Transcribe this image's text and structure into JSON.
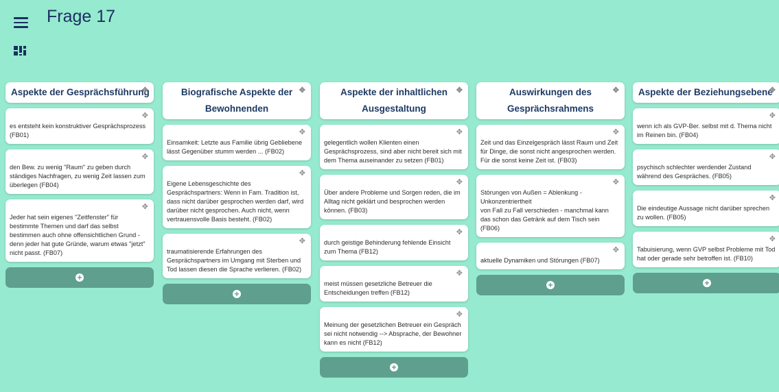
{
  "header": {
    "title": "Frage 17"
  },
  "icons": {
    "menu": "hamburger-menu-icon",
    "board": "board-layout-icon",
    "move": "move-arrows-icon",
    "add": "plus-circle-icon"
  },
  "glyphs": {
    "move": "✥",
    "add": "+"
  },
  "columns": [
    {
      "title": "Aspekte der Gesprächsführung",
      "cards": [
        "es entsteht kein konstruktiver Gesprächsprozess (FB01)",
        "den Bew. zu wenig \"Raum\" zu geben durch ständiges Nachfragen, zu wenig Zeit lassen zum überlegen (FB04)",
        "Jeder hat sein eigenes \"Zeitfenster\" für bestimmte Themen und darf das selbst bestimmen auch ohne offensichtlichen Grund - denn jeder hat gute Gründe, warum etwas \"jetzt\" nicht passt. (FB07)"
      ]
    },
    {
      "title": "Biografische Aspekte der Bewohnenden",
      "cards": [
        "Einsamkeit: Letzte aus Familie übrig Gebliebene lässt Gegenüber stumm werden ... (FB02)",
        "Eigene Lebensgeschichte des Gesprächspartners: Wenn in Fam. Tradition ist, dass nicht darüber gesprochen werden darf, wird darüber nicht gesprochen. Auch nicht, wenn vertrauensvolle Basis besteht. (FB02)",
        "traumatisierende Erfahrungen des Gesprächspartners im Umgang mit Sterben und Tod lassen diesen die Sprache verlieren. (FB02)"
      ]
    },
    {
      "title": "Aspekte der inhaltlichen Ausgestaltung",
      "cards": [
        "gelegentlich wollen Klienten einen Gesprächsprozess, sind aber nicht bereit sich mit dem Thema auseinander zu setzen (FB01)",
        "Über andere Probleme und Sorgen reden, die im Alltag nicht geklärt und besprochen werden können. (FB03)",
        "durch geistige Behinderung fehlende Einsicht zum Thema (FB12)",
        "meist müssen gesetzliche Betreuer die Entscheidungen treffen (FB12)",
        "Meinung der gesetzlichen Betreuer ein Gespräch sei nicht notwendig --> Absprache, der Bewohner kann es nicht (FB12)"
      ]
    },
    {
      "title": "Auswirkungen des Gesprächsrahmens",
      "cards": [
        "Zeit und das Einzelgespräch lässt Raum und Zeit für Dinge, die sonst nicht angesprochen werden. Für die sonst keine Zeit ist. (FB03)",
        "Störungen von Außen = Ablenkung - Unkonzentriertheit\nvon Fall zu Fall verschieden - manchmal kann das schon das Getränk auf dem Tisch sein (FB06)",
        "aktuelle Dynamiken und Störungen (FB07)"
      ]
    },
    {
      "title": "Aspekte der Beziehungsebene",
      "cards": [
        "wenn ich als GVP-Ber. selbst mit d. Thema nicht im Reinen bin. (FB04)",
        "psychisch schlechter werdender Zustand während des Gespräches. (FB05)",
        "Die eindeutige Aussage nicht darüber sprechen zu wollen. (FB05)",
        "Tabuisierung, wenn GVP selbst Probleme mit Tod hat oder gerade sehr betroffen ist. (FB10)"
      ]
    }
  ]
}
